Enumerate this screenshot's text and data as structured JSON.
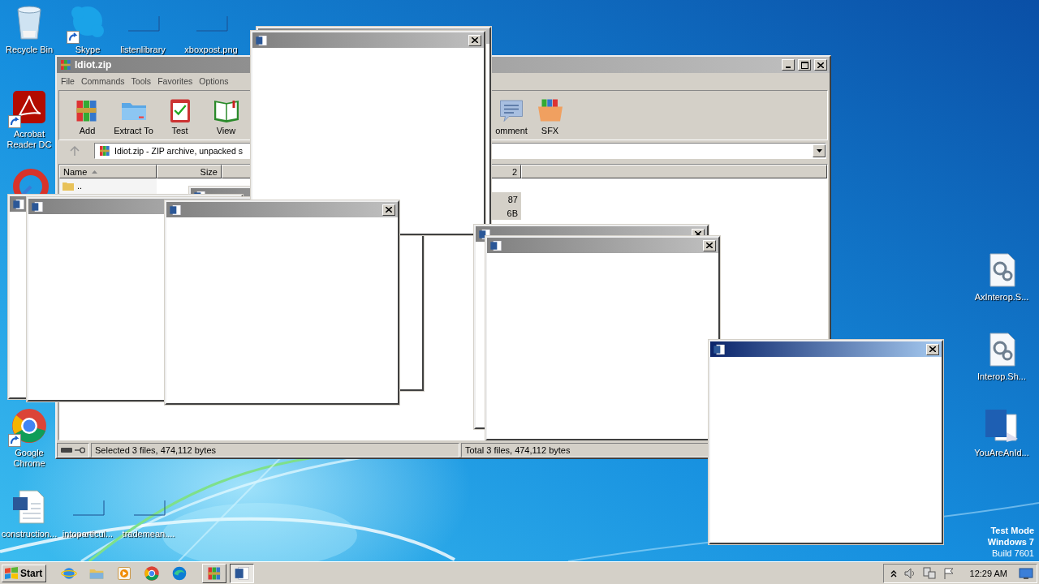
{
  "desktop_icons": [
    {
      "label": "Recycle Bin",
      "kind": "recycle-bin",
      "shortcut": false
    },
    {
      "label": "Skype",
      "kind": "cloud",
      "shortcut": true
    },
    {
      "label": "listenlibrary",
      "kind": "blank",
      "shortcut": false
    },
    {
      "label": "xboxpost.png",
      "kind": "blank",
      "shortcut": false
    },
    {
      "label": "Acrobat Reader DC",
      "kind": "acrobat",
      "shortcut": true
    },
    {
      "kind": "ccleaner",
      "shortcut": false
    },
    {
      "label": "Google Chrome",
      "kind": "chrome",
      "shortcut": true
    },
    {
      "label": "construction...",
      "kind": "word-doc",
      "shortcut": false
    },
    {
      "label": "intoparticul...",
      "kind": "blank",
      "shortcut": false
    },
    {
      "label": "trademean....",
      "kind": "blank",
      "shortcut": false
    },
    {
      "label": "AxInterop.S...",
      "kind": "config",
      "shortcut": false
    },
    {
      "label": "Interop.Sh...",
      "kind": "config",
      "shortcut": false
    },
    {
      "label": "YouAreAnId...",
      "kind": "word-app",
      "shortcut": false
    }
  ],
  "archive_window": {
    "title": "Idiot.zip",
    "menu": [
      "File",
      "Commands",
      "Tools",
      "Favorites",
      "Options"
    ],
    "toolbar": [
      {
        "label": "Add",
        "kind": "add"
      },
      {
        "label": "Extract To",
        "kind": "extract"
      },
      {
        "label": "Test",
        "kind": "test"
      },
      {
        "label": "View",
        "kind": "view"
      },
      {
        "label": "omment",
        "kind": "comment"
      },
      {
        "label": "SFX",
        "kind": "sfx"
      }
    ],
    "address": "Idiot.zip - ZIP archive, unpacked s",
    "columns": [
      {
        "label": "Name",
        "sorted": true
      },
      {
        "label": "Size",
        "sorted": false
      },
      {
        "label": "2",
        "sorted": false
      }
    ],
    "rows": [
      {
        "name": "..",
        "selected": false
      },
      {
        "column_3": "87",
        "selected": true
      },
      {
        "column_3": "6B",
        "selected": true
      }
    ],
    "status": [
      "Selected 3 files, 474,112 bytes",
      "Total 3 files, 474,112 bytes"
    ]
  },
  "popups": [
    {
      "active": false
    },
    {
      "active": false
    },
    {
      "active": false
    },
    {
      "active": false
    },
    {
      "active": false
    },
    {
      "active": false
    },
    {
      "active": false
    },
    {
      "active": false
    },
    {
      "active": true
    }
  ],
  "os_stamp": [
    "Test Mode",
    "Windows 7",
    "Build 7601"
  ],
  "taskbar": {
    "start": "Start",
    "quick_launch": [
      {
        "kind": "ie"
      },
      {
        "kind": "explorer"
      },
      {
        "kind": "media"
      },
      {
        "kind": "chrome"
      },
      {
        "kind": "edge"
      }
    ],
    "tasks": [
      {
        "kind": "winrar",
        "selected": false
      },
      {
        "kind": "word",
        "selected": true
      }
    ],
    "clock": "12:29 AM"
  }
}
